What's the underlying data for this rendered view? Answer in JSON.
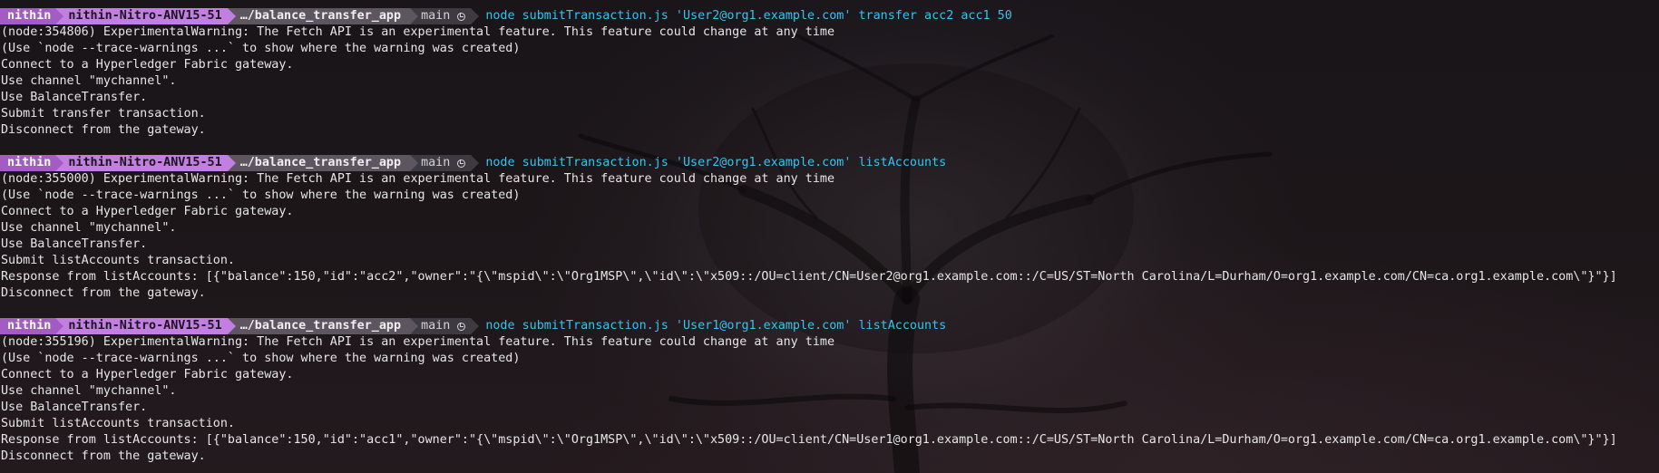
{
  "prompt": {
    "user": "nithin",
    "host": "nithin-Nitro-ANV15-51",
    "dir": "…/balance_transfer_app",
    "branch": "main"
  },
  "blocks": [
    {
      "command": "node submitTransaction.js 'User2@org1.example.com' transfer acc2 acc1 50",
      "output": [
        "(node:354806) ExperimentalWarning: The Fetch API is an experimental feature. This feature could change at any time",
        "(Use `node --trace-warnings ...` to show where the warning was created)",
        "Connect to a Hyperledger Fabric gateway.",
        "Use channel \"mychannel\".",
        "Use BalanceTransfer.",
        "Submit transfer transaction.",
        "Disconnect from the gateway."
      ]
    },
    {
      "command": "node submitTransaction.js 'User2@org1.example.com' listAccounts",
      "output": [
        "(node:355000) ExperimentalWarning: The Fetch API is an experimental feature. This feature could change at any time",
        "(Use `node --trace-warnings ...` to show where the warning was created)",
        "Connect to a Hyperledger Fabric gateway.",
        "Use channel \"mychannel\".",
        "Use BalanceTransfer.",
        "Submit listAccounts transaction.",
        "Response from listAccounts: [{\"balance\":150,\"id\":\"acc2\",\"owner\":\"{\\\"mspid\\\":\\\"Org1MSP\\\",\\\"id\\\":\\\"x509::/OU=client/CN=User2@org1.example.com::/C=US/ST=North Carolina/L=Durham/O=org1.example.com/CN=ca.org1.example.com\\\"}\"}]",
        "Disconnect from the gateway."
      ]
    },
    {
      "command": "node submitTransaction.js 'User1@org1.example.com' listAccounts",
      "output": [
        "(node:355196) ExperimentalWarning: The Fetch API is an experimental feature. This feature could change at any time",
        "(Use `node --trace-warnings ...` to show where the warning was created)",
        "Connect to a Hyperledger Fabric gateway.",
        "Use channel \"mychannel\".",
        "Use BalanceTransfer.",
        "Submit listAccounts transaction.",
        "Response from listAccounts: [{\"balance\":150,\"id\":\"acc1\",\"owner\":\"{\\\"mspid\\\":\\\"Org1MSP\\\",\\\"id\\\":\\\"x509::/OU=client/CN=User1@org1.example.com::/C=US/ST=North Carolina/L=Durham/O=org1.example.com/CN=ca.org1.example.com\\\"}\"}]",
        "Disconnect from the gateway."
      ]
    }
  ],
  "colors": {
    "user_segment": "#a45bc4",
    "host_segment": "#c27ee0",
    "dir_segment": "#5d555f",
    "git_segment": "#3e3a41",
    "command_text": "#35c3f0",
    "output_text": "#e6e6e6",
    "background": "#1c1619"
  },
  "icons": {
    "git_status": "git-status-icon"
  }
}
